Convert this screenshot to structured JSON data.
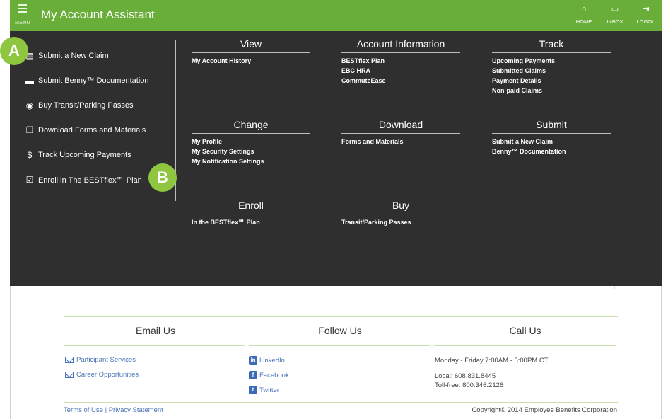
{
  "topbar": {
    "menu_label": "MENU",
    "title": "My Account Assistant",
    "icons": [
      {
        "name": "home-icon",
        "glyph": "⌂",
        "label": "HOME"
      },
      {
        "name": "inbox-icon",
        "glyph": "▭",
        "label": "INBOX"
      },
      {
        "name": "logout-icon",
        "glyph": "⇥",
        "label": "LOGOU"
      }
    ]
  },
  "left_menu": [
    {
      "icon": "document-icon",
      "glyph": "▤",
      "label": "Submit a New Claim"
    },
    {
      "icon": "card-icon",
      "glyph": "▬",
      "label": "Submit Benny™ Documentation"
    },
    {
      "icon": "car-icon",
      "glyph": "◉",
      "label": "Buy Transit/Parking Passes"
    },
    {
      "icon": "copy-icon",
      "glyph": "❐",
      "label": "Download Forms and Materials"
    },
    {
      "icon": "dollar-icon",
      "glyph": "$",
      "label": "Track Upcoming Payments"
    },
    {
      "icon": "checkbox-icon",
      "glyph": "☑",
      "label": "Enroll in The BESTflex℠ Plan"
    }
  ],
  "sections": {
    "view": {
      "title": "View",
      "links": [
        "My Account History"
      ]
    },
    "account": {
      "title": "Account Information",
      "links": [
        "BESTflex Plan",
        "EBC HRA",
        "CommuteEase"
      ]
    },
    "track": {
      "title": "Track",
      "links": [
        "Upcoming Payments",
        "Submitted Claims",
        "Payment Details",
        "Non-paid Claims"
      ]
    },
    "change": {
      "title": "Change",
      "links": [
        "My Profile",
        "My Security Settings",
        "My Notification Settings"
      ]
    },
    "download": {
      "title": "Download",
      "links": [
        "Forms and Materials"
      ]
    },
    "submit": {
      "title": "Submit",
      "links": [
        "Submit a New Claim",
        "Benny™ Documentation"
      ]
    },
    "enroll": {
      "title": "Enroll",
      "links": [
        "In the BESTflex℠ Plan"
      ]
    },
    "buy": {
      "title": "Buy",
      "links": [
        "Transit/Parking Passes"
      ]
    }
  },
  "badges": {
    "a": "A",
    "b": "B"
  },
  "footer": {
    "email_title": "Email Us",
    "follow_title": "Follow Us",
    "call_title": "Call Us",
    "email_links": [
      "Participant Services",
      "Career Opportunities"
    ],
    "social_links": [
      {
        "glyph": "in",
        "label": "LinkedIn"
      },
      {
        "glyph": "f",
        "label": "Facebook"
      },
      {
        "glyph": "t",
        "label": "Twitter"
      }
    ],
    "hours": "Monday - Friday 7:00AM - 5:00PM CT",
    "local": "Local: 608.831.8445",
    "tollfree": "Toll-free: 800.346.2126",
    "terms": "Terms of Use",
    "privacy": "Privacy Statement",
    "separator": " | ",
    "copyright": "Copyright© 2014 Employee Benefits Corporation"
  },
  "colors": {
    "green": "#6aae3a",
    "badge_green": "#8ec63f",
    "dark_panel": "#2f2f2f",
    "link_blue": "#4a74b8"
  }
}
